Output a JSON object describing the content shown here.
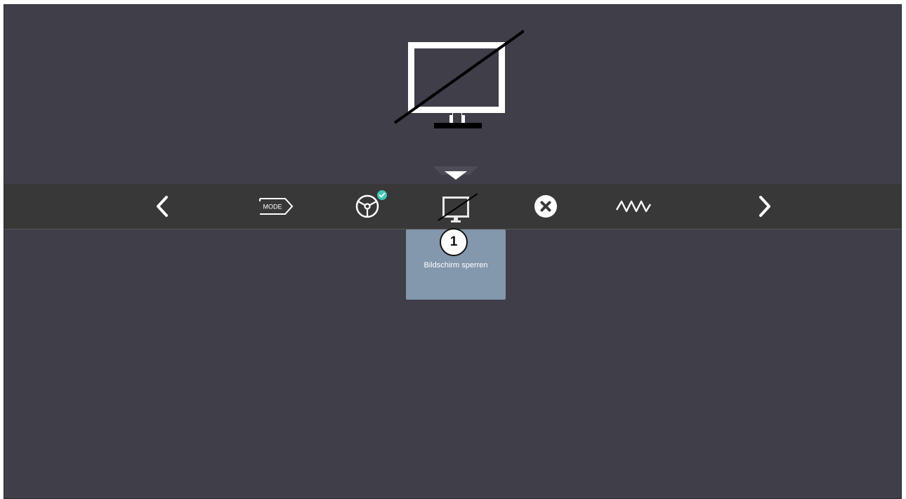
{
  "hero": {
    "icon": "screen-locked-icon"
  },
  "indicator": {
    "icon": "caret-down-icon"
  },
  "toolbar": {
    "items": [
      {
        "icon": "chevron-left-icon"
      },
      {
        "icon": "mode-icon",
        "label": "MODE"
      },
      {
        "icon": "steering-wheel-icon",
        "badge_icon": "check-icon"
      },
      {
        "icon": "screen-lock-icon",
        "selected": true
      },
      {
        "icon": "close-circle-icon"
      },
      {
        "icon": "zigzag-icon"
      },
      {
        "icon": "chevron-right-icon"
      }
    ]
  },
  "tile": {
    "label": "Bildschirm sperren"
  },
  "callout": {
    "number": "1"
  },
  "colors": {
    "background": "#403e48",
    "toolbar": "#383838",
    "tile": "#8397ad",
    "badge": "#3fc6b6",
    "icon": "#ffffff"
  }
}
